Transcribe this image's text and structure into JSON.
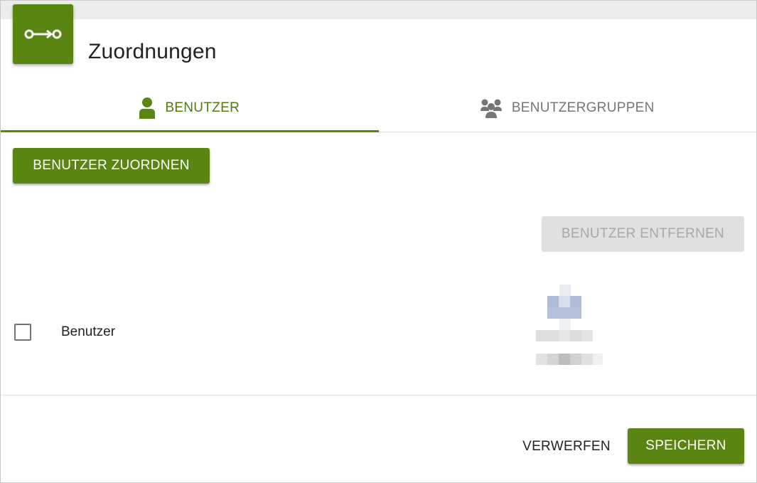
{
  "header": {
    "title": "Zuordnungen",
    "icon": "assignment-arrow-icon",
    "accent_color": "#5a8513"
  },
  "tabs": [
    {
      "label": "BENUTZER",
      "icon": "person-icon",
      "active": true
    },
    {
      "label": "BENUTZERGRUPPEN",
      "icon": "group-icon",
      "active": false
    }
  ],
  "actions": {
    "assign_label": "BENUTZER ZUORDNEN",
    "remove_label": "BENUTZER ENTFERNEN",
    "remove_enabled": false
  },
  "table": {
    "header_checkbox_checked": false,
    "column_label": "Benutzer",
    "rows": [
      {
        "avatar": "pixelated-user-image",
        "checked": false
      }
    ]
  },
  "footer": {
    "discard_label": "VERWERFEN",
    "save_label": "SPEICHERN"
  }
}
